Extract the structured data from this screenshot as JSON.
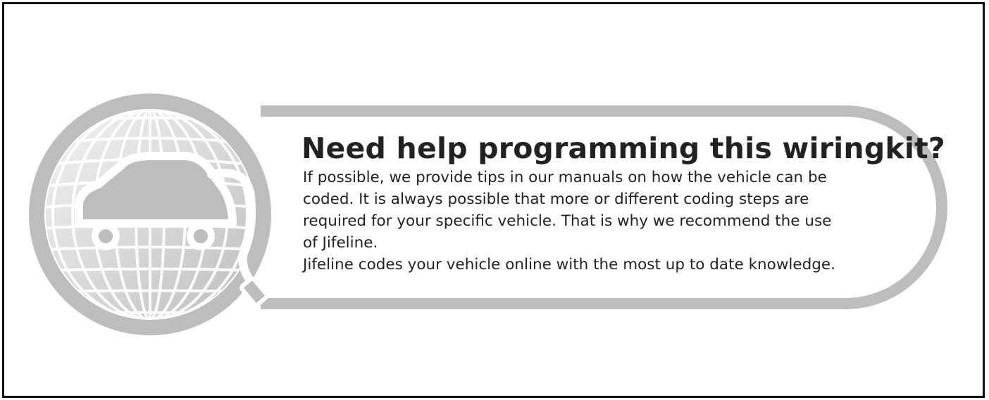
{
  "notice": {
    "heading": "Need help programming this wiringkit?",
    "lines": [
      "If possible, we provide tips in our manuals on how the vehicle can be",
      "coded. It is always possible that more or different coding steps are",
      "required for your specific vehicle. That is why we recommend the use",
      "of Jifeline.",
      "Jifeline codes your vehicle online with the most up to date knowledge."
    ]
  },
  "emblem": {
    "icon": "globe-car-plug-icon",
    "color": "#bdbdbd"
  }
}
